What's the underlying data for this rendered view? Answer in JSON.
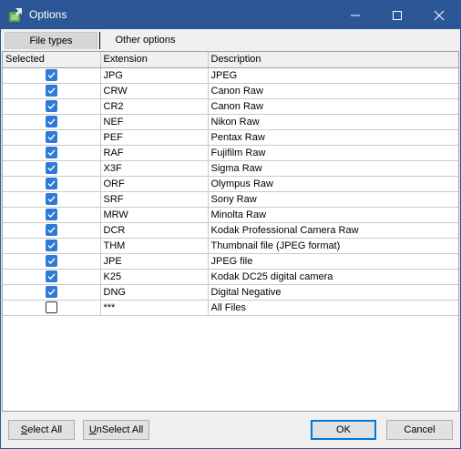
{
  "window": {
    "title": "Options",
    "accent_color": "#2b5797"
  },
  "tabs": [
    {
      "label": "File types",
      "active": true
    },
    {
      "label": "Other options",
      "active": false
    }
  ],
  "grid": {
    "columns": [
      "Selected",
      "Extension",
      "Description"
    ],
    "rows": [
      {
        "selected": true,
        "extension": "JPG",
        "description": "JPEG"
      },
      {
        "selected": true,
        "extension": "CRW",
        "description": "Canon Raw"
      },
      {
        "selected": true,
        "extension": "CR2",
        "description": "Canon Raw"
      },
      {
        "selected": true,
        "extension": "NEF",
        "description": "Nikon Raw"
      },
      {
        "selected": true,
        "extension": "PEF",
        "description": "Pentax Raw"
      },
      {
        "selected": true,
        "extension": "RAF",
        "description": "Fujifilm Raw"
      },
      {
        "selected": true,
        "extension": "X3F",
        "description": "Sigma Raw"
      },
      {
        "selected": true,
        "extension": "ORF",
        "description": "Olympus Raw"
      },
      {
        "selected": true,
        "extension": "SRF",
        "description": "Sony Raw"
      },
      {
        "selected": true,
        "extension": "MRW",
        "description": "Minolta Raw"
      },
      {
        "selected": true,
        "extension": "DCR",
        "description": "Kodak Professional Camera Raw"
      },
      {
        "selected": true,
        "extension": "THM",
        "description": "Thumbnail file (JPEG format)"
      },
      {
        "selected": true,
        "extension": "JPE",
        "description": "JPEG file"
      },
      {
        "selected": true,
        "extension": "K25",
        "description": "Kodak DC25 digital camera"
      },
      {
        "selected": true,
        "extension": "DNG",
        "description": "Digital Negative"
      },
      {
        "selected": false,
        "extension": "***",
        "description": "All Files"
      }
    ]
  },
  "buttons": {
    "select_all": {
      "accel": "S",
      "rest": "elect All"
    },
    "unselect_all": {
      "accel": "U",
      "rest": "nSelect All"
    },
    "ok": "OK",
    "cancel": "Cancel"
  },
  "icons": {
    "app": "app-options-icon",
    "minimize": "minimize-icon",
    "maximize": "maximize-icon",
    "close": "close-icon",
    "checkbox_checked": "checkbox-checked-icon"
  },
  "colors": {
    "checkbox_checked": "#2f79d8",
    "default_button_border": "#0078d7"
  }
}
